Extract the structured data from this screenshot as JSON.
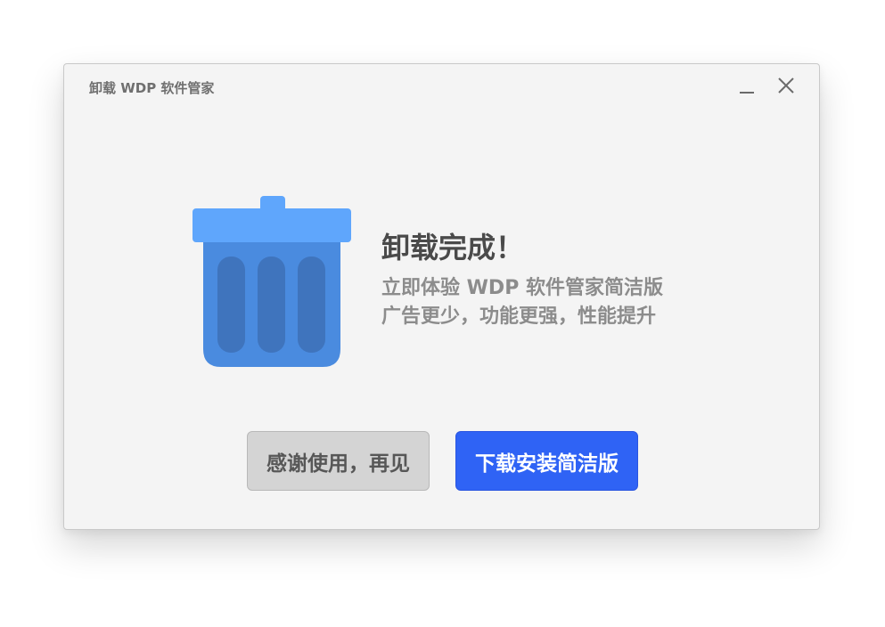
{
  "window": {
    "title": "卸载 WDP 软件管家"
  },
  "controls": {
    "minimize_icon": "minimize-icon",
    "close_icon": "close-icon"
  },
  "illustration": {
    "icon": "trash-bin-icon",
    "lid_color": "#5fa6fc",
    "body_color": "#4a8bdf",
    "slot_color": "#3f74bd"
  },
  "message": {
    "headline": "卸载完成！",
    "line1": "立即体验 WDP 软件管家简洁版",
    "line2": "广告更少，功能更强，性能提升"
  },
  "buttons": {
    "goodbye_label": "感谢使用，再见",
    "download_label": "下载安装简洁版",
    "primary_color": "#2f63f5",
    "secondary_color": "#d4d4d4"
  }
}
